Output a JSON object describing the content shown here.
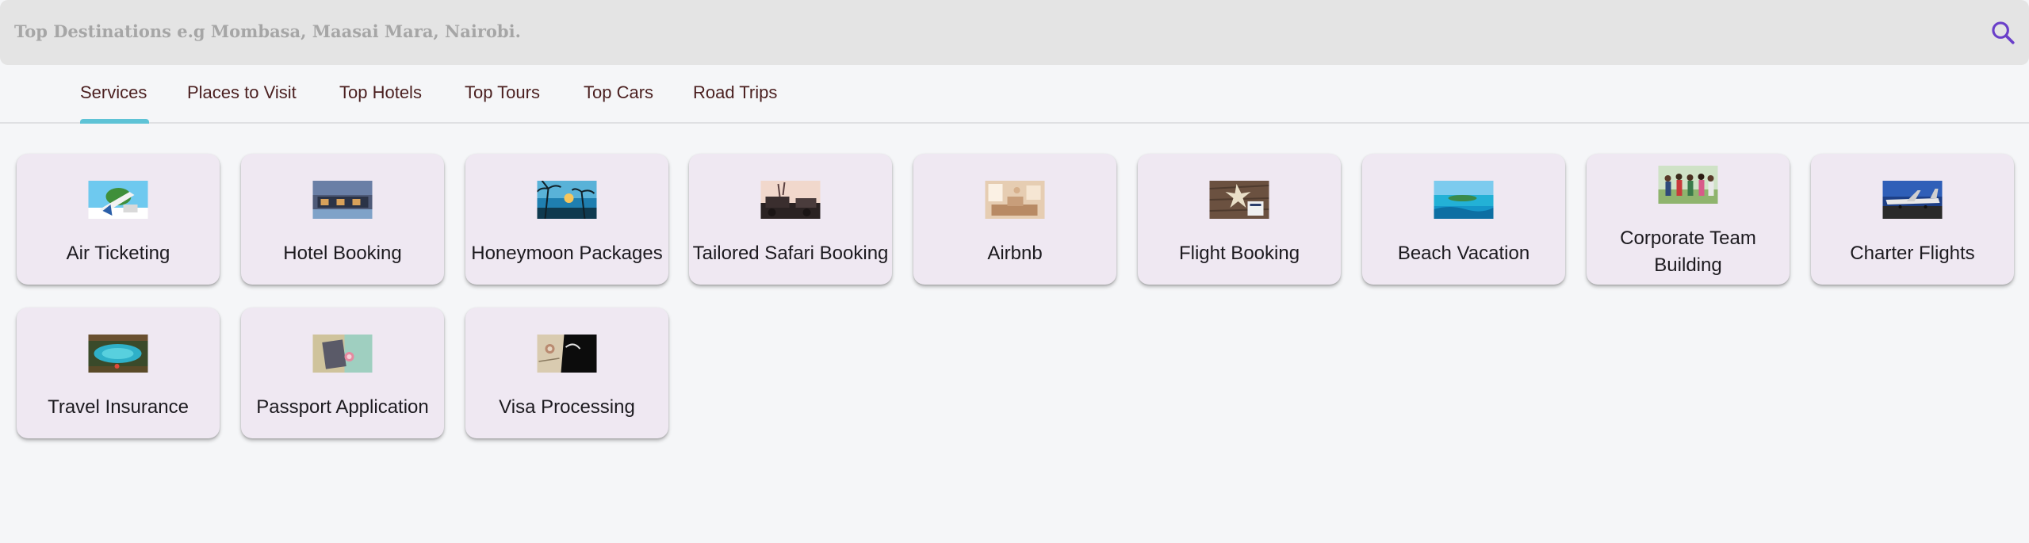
{
  "search": {
    "placeholder": "Top Destinations e.g Mombasa, Maasai Mara, Nairobi.",
    "icon": "search-icon",
    "icon_color": "#6a3fc9"
  },
  "tabs": [
    {
      "label": "Services",
      "active": true
    },
    {
      "label": "Places to Visit",
      "active": false
    },
    {
      "label": "Top Hotels",
      "active": false
    },
    {
      "label": "Top Tours",
      "active": false
    },
    {
      "label": "Top Cars",
      "active": false
    },
    {
      "label": "Road Trips",
      "active": false
    }
  ],
  "colors": {
    "tab_text": "#4a1f1f",
    "tab_indicator": "#5ec3d6",
    "card_bg": "#efe8f2",
    "page_bg": "#f5f6f8"
  },
  "services": [
    {
      "label": "Air Ticketing",
      "image": "air-ticketing-image"
    },
    {
      "label": "Hotel Booking",
      "image": "hotel-booking-image"
    },
    {
      "label": "Honeymoon Packages",
      "image": "honeymoon-packages-image"
    },
    {
      "label": "Tailored Safari Booking",
      "image": "tailored-safari-image"
    },
    {
      "label": "Airbnb",
      "image": "airbnb-image"
    },
    {
      "label": "Flight Booking",
      "image": "flight-booking-image"
    },
    {
      "label": "Beach Vacation",
      "image": "beach-vacation-image"
    },
    {
      "label": "Corporate Team Building",
      "image": "corporate-team-building-image"
    },
    {
      "label": "Charter Flights",
      "image": "charter-flights-image"
    },
    {
      "label": "Travel Insurance",
      "image": "travel-insurance-image"
    },
    {
      "label": "Passport Application",
      "image": "passport-application-image"
    },
    {
      "label": "Visa Processing",
      "image": "visa-processing-image"
    }
  ]
}
